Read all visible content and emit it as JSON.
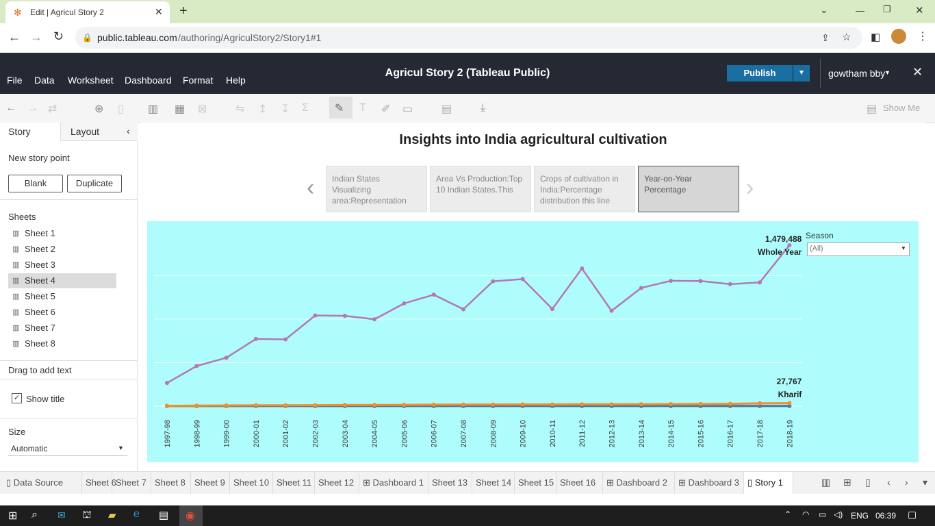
{
  "browser": {
    "tab_title": "Edit | Agricul Story 2",
    "url_host": "public.tableau.com",
    "url_path": "/authoring/AgriculStory2/Story1#1"
  },
  "app": {
    "title": "Agricul Story 2 (Tableau Public)",
    "publish_label": "Publish",
    "user": "gowtham bby",
    "menus": [
      "File",
      "Data",
      "Worksheet",
      "Dashboard",
      "Format",
      "Help"
    ],
    "show_me": "Show Me"
  },
  "left_pane": {
    "tab_story": "Story",
    "tab_layout": "Layout",
    "new_story_point": "New story point",
    "blank_label": "Blank",
    "duplicate_label": "Duplicate",
    "sheets_header": "Sheets",
    "sheets": [
      "Sheet 1",
      "Sheet 2",
      "Sheet 3",
      "Sheet 4",
      "Sheet 5",
      "Sheet 6",
      "Sheet 7",
      "Sheet 8"
    ],
    "selected_sheet": "Sheet 4",
    "drag_text": "Drag to add text",
    "show_title": "Show title",
    "size_label": "Size",
    "size_value": "Automatic"
  },
  "story": {
    "title": "Insights into India agricultural cultivation",
    "points": [
      "Indian States Visualizing area:Representation",
      "Area Vs Production:Top 10 Indian States.This",
      "Crops of cultivation in India:Percentage distribution this line",
      "Year-on-Year Percentage"
    ],
    "active_point_index": 3,
    "filter_label": "Season",
    "filter_value": "(All)"
  },
  "chart_data": {
    "type": "line",
    "x": [
      "1997-98",
      "1998-99",
      "1999-00",
      "2000-01",
      "2001-02",
      "2002-03",
      "2003-04",
      "2004-05",
      "2005-06",
      "2006-07",
      "2007-08",
      "2008-09",
      "2009-10",
      "2010-11",
      "2011-12",
      "2012-13",
      "2013-14",
      "2014-15",
      "2015-16",
      "2016-17",
      "2017-18",
      "2018-19"
    ],
    "series": [
      {
        "name": "Whole Year",
        "color": "#b478b0",
        "values": [
          213000,
          369000,
          445000,
          618000,
          614000,
          834000,
          831000,
          799000,
          945000,
          1025000,
          891000,
          1148000,
          1169000,
          894000,
          1266000,
          877000,
          1087000,
          1153000,
          1151000,
          1122000,
          1138000,
          1479488
        ]
      },
      {
        "name": "Kharif",
        "color": "#f28e2b",
        "values": [
          3000,
          5000,
          6000,
          8000,
          8000,
          9000,
          10000,
          11000,
          12000,
          13000,
          14000,
          15000,
          15500,
          16000,
          17000,
          17000,
          18000,
          19000,
          20000,
          21000,
          26000,
          27767
        ]
      },
      {
        "name": "",
        "color": "#4e79a7",
        "values": [
          2000,
          2000,
          2000,
          2000,
          2000,
          2000,
          2000,
          2000,
          2000,
          2000,
          2000,
          2000,
          2000,
          2000,
          2000,
          2000,
          2000,
          2000,
          2000,
          2000,
          2000,
          2000
        ]
      },
      {
        "name": "",
        "color": "#59a14f",
        "values": [
          1000,
          1000,
          1000,
          1000,
          1000,
          1000,
          1000,
          1000,
          1000,
          1000,
          1000,
          1000,
          1000,
          1000,
          1000,
          1000,
          1000,
          1000,
          1000,
          1000,
          1000,
          1000
        ]
      }
    ],
    "ylim": [
      0,
      1600000
    ],
    "labels": [
      {
        "value": "1,479,488",
        "series": "Whole Year"
      },
      {
        "value": "27,767",
        "series": "Kharif"
      }
    ],
    "grid": true
  },
  "bottom_tabs": [
    "Data Source",
    "Sheet 6",
    "Sheet 7",
    "Sheet 8",
    "Sheet 9",
    "Sheet 10",
    "Sheet 11",
    "Sheet 12",
    "Dashboard 1",
    "Sheet 13",
    "Sheet 14",
    "Sheet 15",
    "Sheet 16",
    "Dashboard 2",
    "Dashboard 3",
    "Story 1"
  ],
  "taskbar": {
    "lang": "ENG",
    "time": "06:39"
  }
}
